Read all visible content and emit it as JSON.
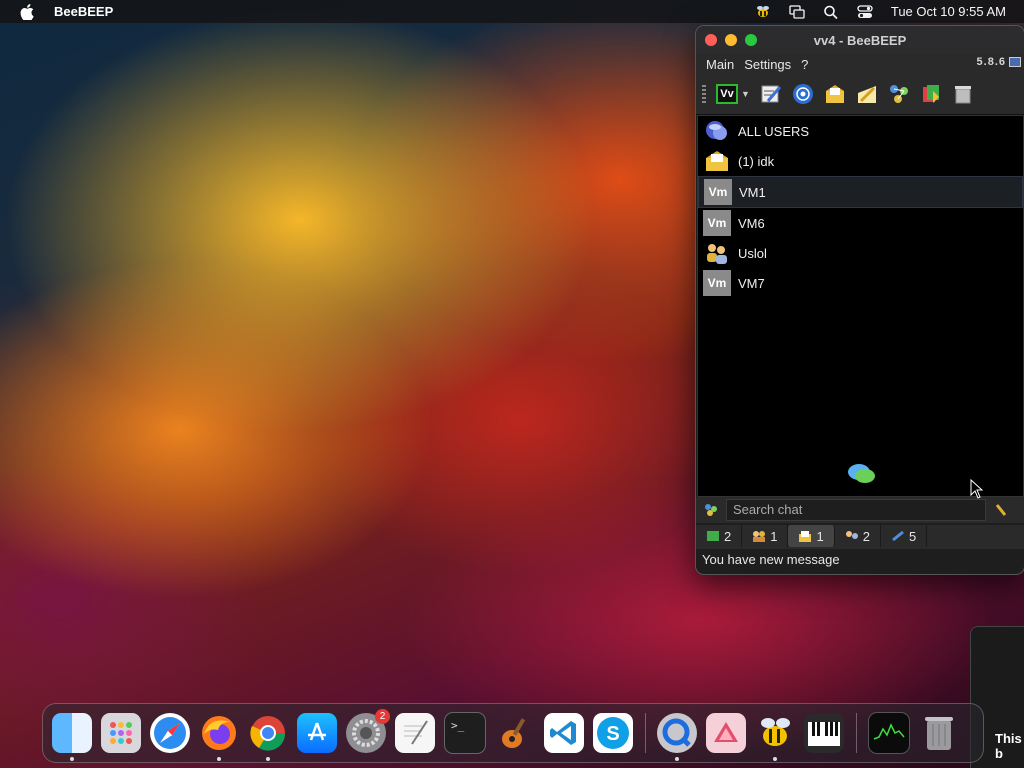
{
  "menubar": {
    "app_name": "BeeBEEP",
    "datetime": "Tue Oct 10  9:55 AM",
    "icons": [
      "apple-icon",
      "beebeep-status-icon",
      "screen-mirroring-icon",
      "spotlight-search-icon",
      "control-center-icon"
    ]
  },
  "window": {
    "title": "vv4 - BeeBEEP",
    "menu": [
      "Main",
      "Settings",
      "?"
    ],
    "version": "5.8.6",
    "toolbar": {
      "profile_label": "Vv",
      "buttons": [
        "edit-profile-icon",
        "broadcast-icon",
        "open-envelope-icon",
        "write-message-icon",
        "network-icon",
        "file-share-icon",
        "clear-trash-icon"
      ]
    },
    "users": [
      {
        "label": "ALL USERS",
        "avatar": "all-users-icon",
        "avatar_text": ""
      },
      {
        "label": "(1) idk",
        "avatar": "unread-message-icon",
        "avatar_text": ""
      },
      {
        "label": "VM1",
        "avatar": "vm-avatar",
        "avatar_text": "Vm",
        "selected": true
      },
      {
        "label": "VM6",
        "avatar": "vm-avatar",
        "avatar_text": "Vm"
      },
      {
        "label": "Uslol",
        "avatar": "group-users-icon",
        "avatar_text": ""
      },
      {
        "label": "VM7",
        "avatar": "vm-avatar",
        "avatar_text": "Vm"
      }
    ],
    "search": {
      "placeholder": "Search chat"
    },
    "tabs": [
      {
        "count": "2",
        "icon": "chat-tab-icon"
      },
      {
        "count": "1",
        "icon": "users-tab-icon"
      },
      {
        "count": "1",
        "icon": "message-tab-icon",
        "active": true
      },
      {
        "count": "2",
        "icon": "groups-tab-icon"
      },
      {
        "count": "5",
        "icon": "network-tab-icon"
      }
    ],
    "status_text": "You have new message"
  },
  "dock": {
    "apps": [
      "Finder",
      "Launchpad",
      "Safari",
      "Firefox",
      "Chrome",
      "App Store",
      "System Settings",
      "TextEdit",
      "Terminal",
      "GarageBand",
      "Visual Studio Code",
      "Skype",
      "QuickTime Player",
      "Affinity Designer",
      "BeeBEEP",
      "Piano",
      "Activity Monitor",
      "Trash"
    ],
    "settings_badge": "2"
  },
  "corner_text": "This\nb"
}
